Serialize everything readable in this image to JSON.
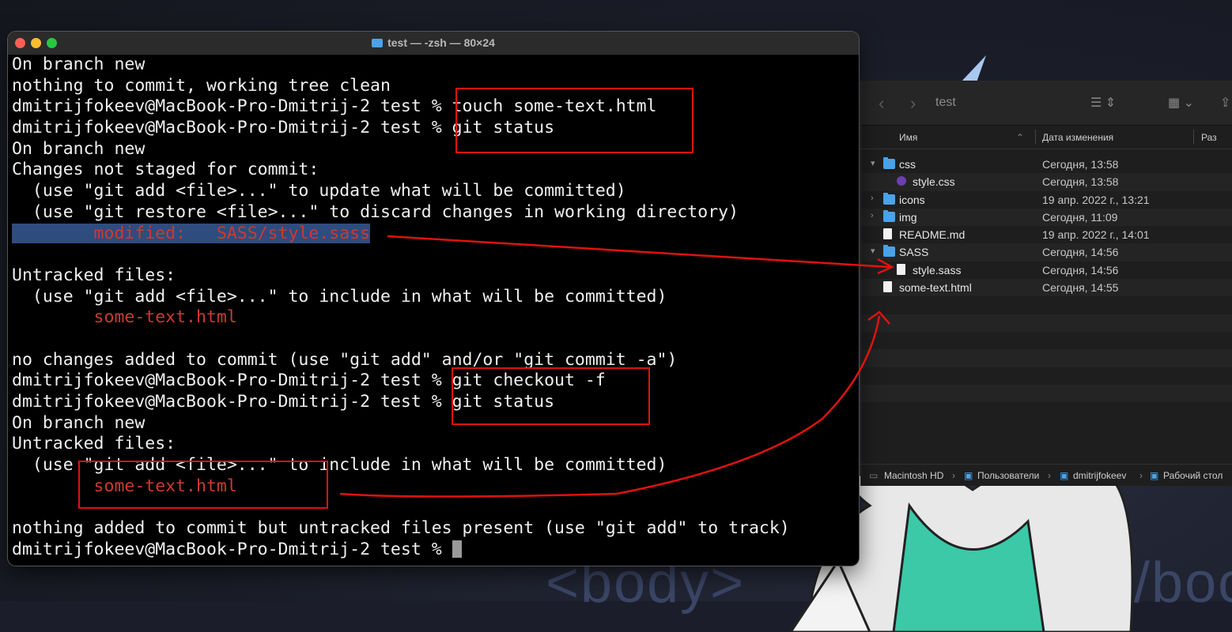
{
  "desktop": {
    "body_tag_left": "<body>",
    "body_tag_right": "</boc"
  },
  "terminal": {
    "title": "test — -zsh — 80×24",
    "lines": [
      {
        "text": "On branch new"
      },
      {
        "text": "nothing to commit, working tree clean"
      },
      {
        "text": "dmitrijfokeev@MacBook-Pro-Dmitrij-2 test % touch some-text.html"
      },
      {
        "text": "dmitrijfokeev@MacBook-Pro-Dmitrij-2 test % git status"
      },
      {
        "text": "On branch new"
      },
      {
        "text": "Changes not staged for commit:"
      },
      {
        "text": "  (use \"git add <file>...\" to update what will be committed)"
      },
      {
        "text": "  (use \"git restore <file>...\" to discard changes in working directory)"
      },
      {
        "text": "        modified:   SASS/style.sass",
        "red": true,
        "selected": true
      },
      {
        "text": ""
      },
      {
        "text": "Untracked files:"
      },
      {
        "text": "  (use \"git add <file>...\" to include in what will be committed)"
      },
      {
        "text": "        some-text.html",
        "red": true
      },
      {
        "text": ""
      },
      {
        "text": "no changes added to commit (use \"git add\" and/or \"git commit -a\")"
      },
      {
        "text": "dmitrijfokeev@MacBook-Pro-Dmitrij-2 test % git checkout -f"
      },
      {
        "text": "dmitrijfokeev@MacBook-Pro-Dmitrij-2 test % git status"
      },
      {
        "text": "On branch new"
      },
      {
        "text": "Untracked files:"
      },
      {
        "text": "  (use \"git add <file>...\" to include in what will be committed)"
      },
      {
        "text": "        some-text.html",
        "red": true
      },
      {
        "text": ""
      },
      {
        "text": "nothing added to commit but untracked files present (use \"git add\" to track)"
      },
      {
        "text": "dmitrijfokeev@MacBook-Pro-Dmitrij-2 test % ",
        "cursor": true
      }
    ]
  },
  "finder": {
    "title": "test",
    "columns": {
      "name": "Имя",
      "date": "Дата изменения",
      "size": "Раз"
    },
    "rows": [
      {
        "name": "css",
        "date": "Сегодня, 13:58",
        "kind": "folder",
        "level": 0,
        "disclosure": "▾"
      },
      {
        "name": "style.css",
        "date": "Сегодня, 13:58",
        "kind": "css",
        "level": 1,
        "disclosure": ""
      },
      {
        "name": "icons",
        "date": "19 апр. 2022 г., 13:21",
        "kind": "folder",
        "level": 0,
        "disclosure": "›"
      },
      {
        "name": "img",
        "date": "Сегодня, 11:09",
        "kind": "folder",
        "level": 0,
        "disclosure": "›"
      },
      {
        "name": "README.md",
        "date": "19 апр. 2022 г., 14:01",
        "kind": "file",
        "level": 0,
        "disclosure": ""
      },
      {
        "name": "SASS",
        "date": "Сегодня, 14:56",
        "kind": "folder",
        "level": 0,
        "disclosure": "▾"
      },
      {
        "name": "style.sass",
        "date": "Сегодня, 14:56",
        "kind": "file",
        "level": 1,
        "disclosure": ""
      },
      {
        "name": "some-text.html",
        "date": "Сегодня, 14:55",
        "kind": "file",
        "level": 0,
        "disclosure": ""
      }
    ],
    "path": [
      "Macintosh HD",
      "Пользователи",
      "dmitrijfokeev",
      "Рабочий стол"
    ]
  },
  "colors": {
    "annotation": "#e0120e",
    "terminal_red": "#cc3a2f",
    "selection": "#2f4c7f"
  }
}
